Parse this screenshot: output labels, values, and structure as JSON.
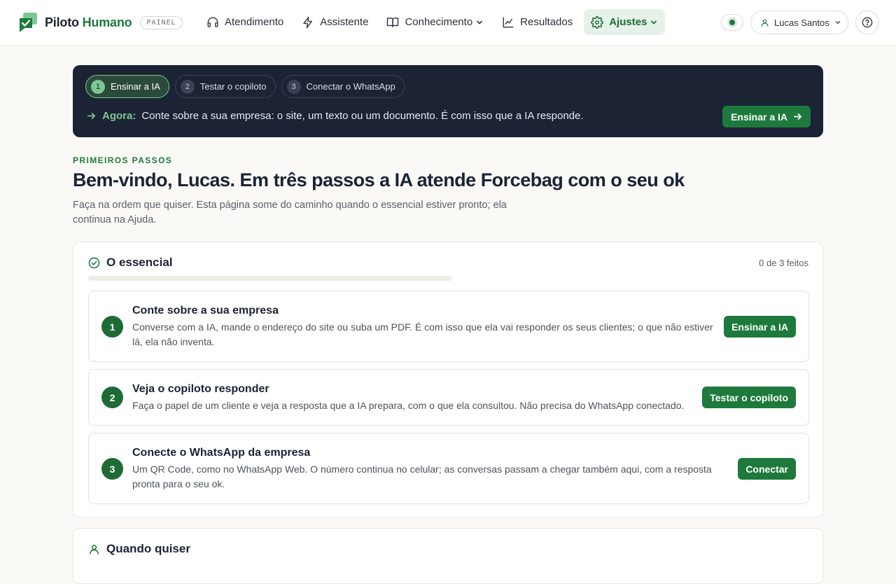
{
  "brand": {
    "name_part1": "Piloto",
    "name_part2": "Humano",
    "badge": "PAINEL"
  },
  "nav": {
    "items": [
      {
        "label": "Atendimento",
        "icon": "headset-icon"
      },
      {
        "label": "Assistente",
        "icon": "bolt-icon"
      },
      {
        "label": "Conhecimento",
        "icon": "book-icon",
        "has_dropdown": true
      },
      {
        "label": "Resultados",
        "icon": "chart-line-icon"
      },
      {
        "label": "Ajustes",
        "icon": "gear-icon",
        "has_dropdown": true,
        "active": true
      }
    ]
  },
  "header_right": {
    "status": "online",
    "user_name": "Lucas Santos"
  },
  "banner": {
    "steps": [
      {
        "num": "1",
        "label": "Ensinar a IA",
        "current": true
      },
      {
        "num": "2",
        "label": "Testar o copiloto"
      },
      {
        "num": "3",
        "label": "Conectar o WhatsApp"
      }
    ],
    "now_label": "Agora:",
    "now_text": "Conte sobre a sua empresa: o site, um texto ou um documento. É com isso que a IA responde.",
    "cta_label": "Ensinar a IA"
  },
  "intro": {
    "eyebrow": "PRIMEIROS PASSOS",
    "headline": "Bem-vindo, Lucas. Em três passos a IA atende Forcebag com o seu ok",
    "subtitle": "Faça na ordem que quiser. Esta página some do caminho quando o essencial estiver pronto; ela continua na Ajuda."
  },
  "essential": {
    "title": "O essencial",
    "count": "0 de 3 feitos",
    "progress": 0,
    "tasks": [
      {
        "num": "1",
        "title": "Conte sobre a sua empresa",
        "desc": "Converse com a IA, mande o endereço do site ou suba um PDF. É com isso que ela vai responder os seus clientes; o que não estiver lá, ela não inventa.",
        "button": "Ensinar a IA"
      },
      {
        "num": "2",
        "title": "Veja o copiloto responder",
        "desc": "Faça o papel de um cliente e veja a resposta que a IA prepara, com o que ela consultou. Não precisa do WhatsApp conectado.",
        "button": "Testar o copiloto"
      },
      {
        "num": "3",
        "title": "Conecte o WhatsApp da empresa",
        "desc": "Um QR Code, como no WhatsApp Web. O número continua no celular; as conversas passam a chegar também aqui, com a resposta pronta para o seu ok.",
        "button": "Conectar"
      }
    ]
  },
  "later": {
    "title": "Quando quiser"
  },
  "colors": {
    "accent": "#1e7a3c",
    "banner_bg": "#1b2334",
    "page_bg": "#faf9f6"
  }
}
